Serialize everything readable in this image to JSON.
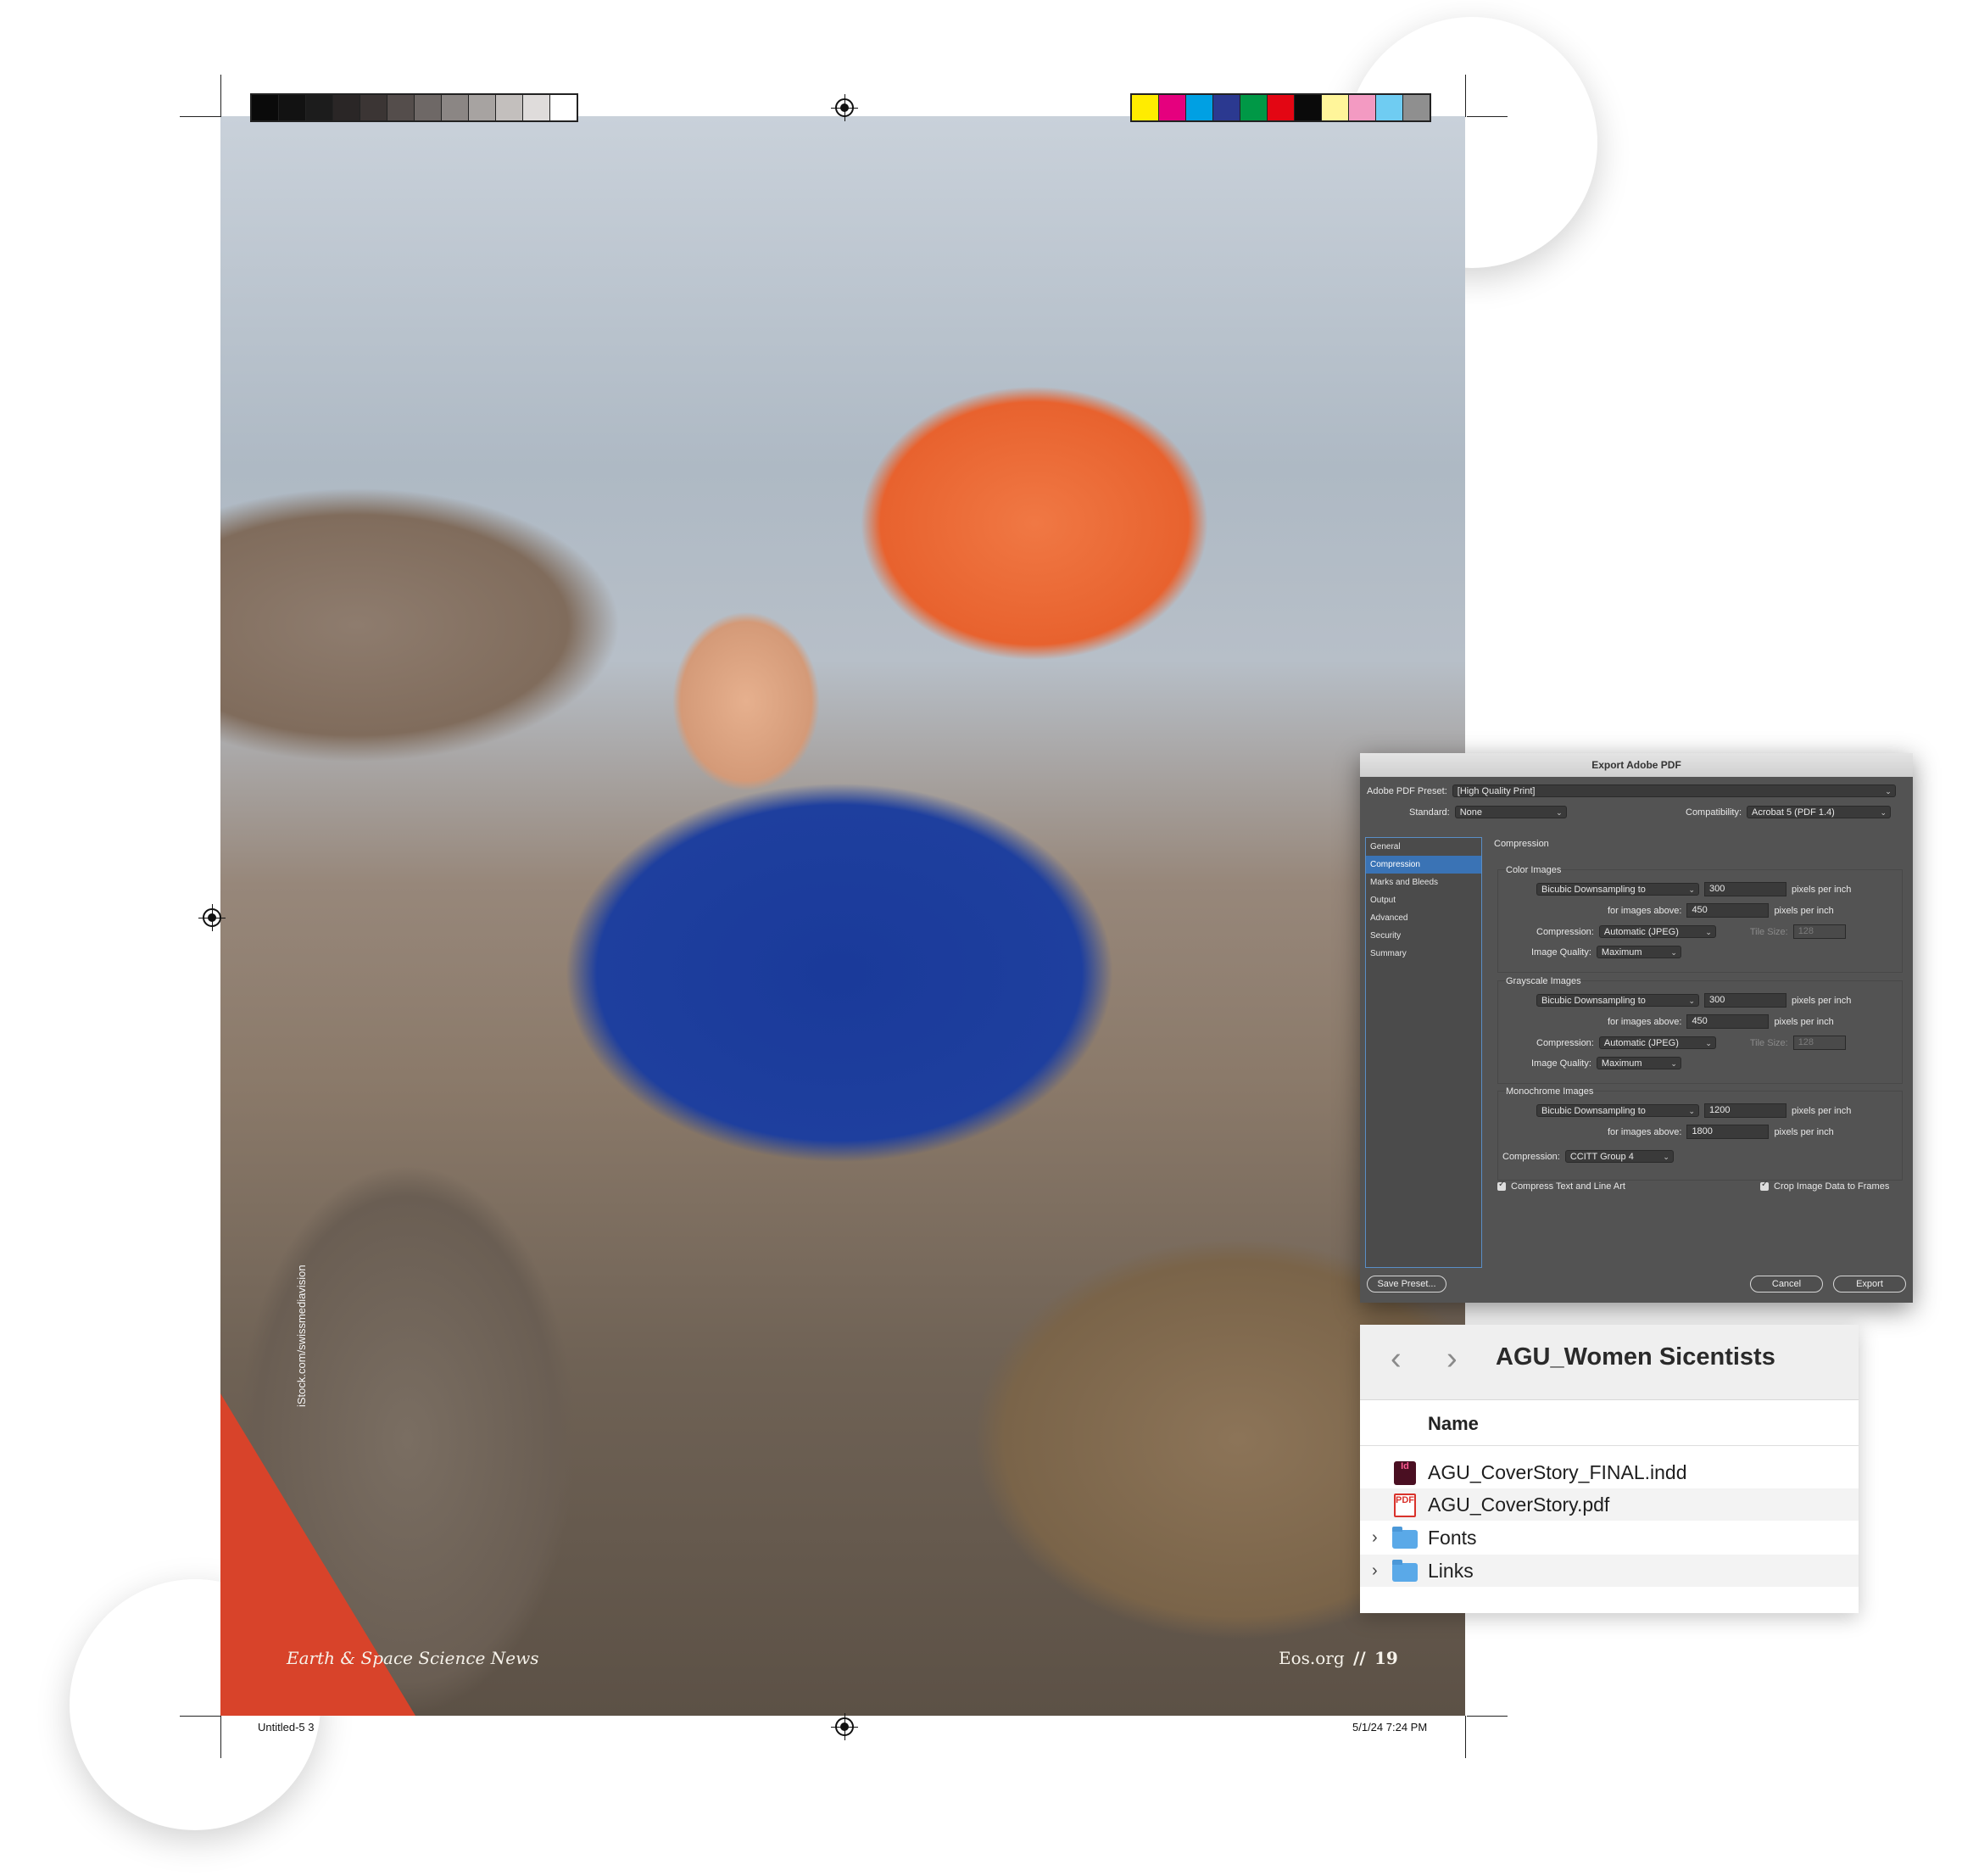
{
  "print_sheet": {
    "photo_credit": "iStock.com/swissmediavision",
    "folio_left": "Earth & Space Science News",
    "folio_right_site": "Eos.org",
    "folio_right_separator": "//",
    "folio_right_page": "19",
    "slug_left": "Untitled-5   3",
    "slug_right": "5/1/24   7:24 PM",
    "gray_bar_colors": [
      "#0a0a0a",
      "#121212",
      "#1c1c1c",
      "#2a2626",
      "#3b3534",
      "#544d4b",
      "#6e6866",
      "#8b8684",
      "#a7a3a1",
      "#c3bfbd",
      "#dfdcdb",
      "#ffffff"
    ],
    "color_bar_colors": [
      "#ffec00",
      "#e5007e",
      "#00a0e3",
      "#2b3990",
      "#009846",
      "#e30613",
      "#0a0a0a",
      "#fff59a",
      "#f39ac2",
      "#6fccf2",
      "#8f8f8f"
    ]
  },
  "export_dialog": {
    "title": "Export Adobe PDF",
    "preset_label": "Adobe PDF Preset:",
    "preset_value": "[High Quality Print]",
    "standard_label": "Standard:",
    "standard_value": "None",
    "compatibility_label": "Compatibility:",
    "compatibility_value": "Acrobat 5 (PDF 1.4)",
    "sidebar_items": [
      "General",
      "Compression",
      "Marks and Bleeds",
      "Output",
      "Advanced",
      "Security",
      "Summary"
    ],
    "active_section": "Compression",
    "section_title": "Compression",
    "color_images": {
      "title": "Color Images",
      "downsampling": "Bicubic Downsampling to",
      "ppi": "300",
      "ppi_unit": "pixels per inch",
      "above_label": "for images above:",
      "above_value": "450",
      "compression_label": "Compression:",
      "compression_value": "Automatic (JPEG)",
      "tile_label": "Tile Size:",
      "tile_value": "128",
      "quality_label": "Image Quality:",
      "quality_value": "Maximum"
    },
    "grayscale_images": {
      "title": "Grayscale Images",
      "downsampling": "Bicubic Downsampling to",
      "ppi": "300",
      "ppi_unit": "pixels per inch",
      "above_label": "for images above:",
      "above_value": "450",
      "compression_label": "Compression:",
      "compression_value": "Automatic (JPEG)",
      "tile_label": "Tile Size:",
      "tile_value": "128",
      "quality_label": "Image Quality:",
      "quality_value": "Maximum"
    },
    "monochrome_images": {
      "title": "Monochrome Images",
      "downsampling": "Bicubic Downsampling to",
      "ppi": "1200",
      "ppi_unit": "pixels per inch",
      "above_label": "for images above:",
      "above_value": "1800",
      "compression_label": "Compression:",
      "compression_value": "CCITT Group 4"
    },
    "compress_text_label": "Compress Text and Line Art",
    "crop_image_label": "Crop Image Data to Frames",
    "save_preset_label": "Save Preset...",
    "cancel_label": "Cancel",
    "export_label": "Export"
  },
  "finder": {
    "title": "AGU_Women Sicentists",
    "column_name": "Name",
    "items": [
      {
        "name": "AGU_CoverStory_FINAL.indd",
        "icon": "indesign-file-icon",
        "icon_text": "Id"
      },
      {
        "name": "AGU_CoverStory.pdf",
        "icon": "pdf-file-icon",
        "icon_text": "PDF"
      },
      {
        "name": "Fonts",
        "icon": "folder-icon"
      },
      {
        "name": "Links",
        "icon": "folder-icon"
      }
    ]
  }
}
